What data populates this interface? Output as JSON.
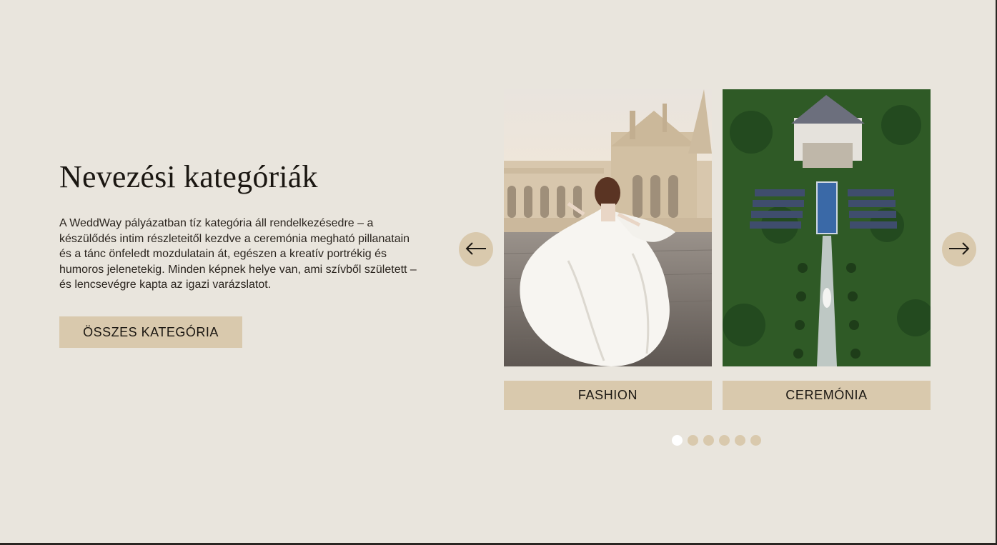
{
  "section": {
    "title": "Nevezési kategóriák",
    "intro": " A WeddWay pályázatban tíz kategória áll rendelkezésedre – a készülődés intim részleteitől kezdve a ceremónia megható pillanatain és a tánc önfeledt mozdulatain át, egészen a kreatív portrékig és humoros jelenetekig. Minden képnek helye van, ami szívből született – és lencsevégre kapta az igazi varázslatot.",
    "button_label": "ÖSSZES KATEGÓRIA"
  },
  "carousel": {
    "prev_icon": "arrow-left-icon",
    "next_icon": "arrow-right-icon",
    "slides": [
      {
        "label": "FASHION",
        "image": "bride-in-white-gown-at-castle-terrace"
      },
      {
        "label": "CEREMÓNIA",
        "image": "aerial-garden-wedding-ceremony"
      }
    ],
    "dot_count": 6,
    "active_dot": 1
  },
  "colors": {
    "background": "#e9e5dd",
    "accent": "#d9c9ad",
    "text": "#1b1712"
  }
}
